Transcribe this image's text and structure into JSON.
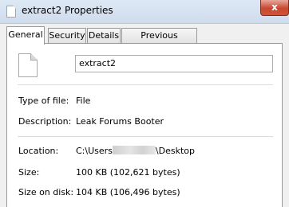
{
  "window": {
    "title": "extract2 Properties",
    "close_label": "x"
  },
  "tabs": [
    {
      "label": "General",
      "active": true
    },
    {
      "label": "Security",
      "active": false
    },
    {
      "label": "Details",
      "active": false
    },
    {
      "label": "Previous Versions",
      "active": false
    }
  ],
  "general": {
    "file_icon": "generic-file-icon",
    "file_name": "extract2",
    "type_label": "Type of file:",
    "type_value": "File",
    "description_label": "Description:",
    "description_value": "Leak Forums Booter",
    "location_label": "Location:",
    "location_prefix": "C:\\Users",
    "location_suffix": "\\Desktop",
    "size_label": "Size:",
    "size_value": "100 KB (102,621 bytes)",
    "size_on_disk_label": "Size on disk:",
    "size_on_disk_value": "104 KB (106,496 bytes)"
  }
}
